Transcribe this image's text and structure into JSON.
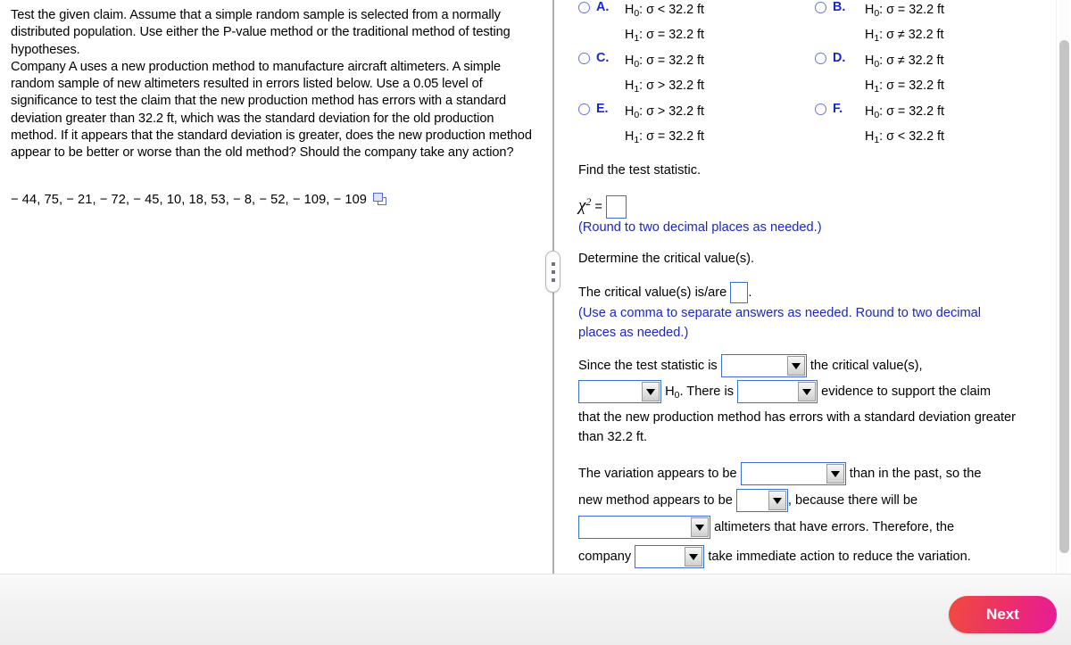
{
  "left_panel": {
    "instructions": "Test the given claim. Assume that a simple random sample is selected from a normally distributed population. Use either the P-value method or the traditional method of testing hypotheses.",
    "problem": "Company A uses a new production method to manufacture aircraft altimeters. A simple random sample of new altimeters resulted in errors listed below. Use a 0.05 level of significance to test the claim that the new production method has errors with a standard deviation greater than 32.2 ft, which was the standard deviation for the old production method. If it appears that the standard deviation is greater, does the new production method appear to be better or worse than the old method? Should the company take any action?",
    "data_values": "− 44, 75, − 21, − 72, − 45, 10, 18, 53, − 8, − 52, − 109, − 109",
    "copy_icon": "copy-to-clipboard-icon"
  },
  "right_panel": {
    "options": [
      {
        "letter": "A.",
        "null_label": "H",
        "null_sub": "0",
        "null_rest": ": σ < 32.2 ft",
        "alt_label": "H",
        "alt_sub": "1",
        "alt_rest": ": σ = 32.2 ft",
        "selected": false
      },
      {
        "letter": "B.",
        "null_label": "H",
        "null_sub": "0",
        "null_rest": ": σ = 32.2 ft",
        "alt_label": "H",
        "alt_sub": "1",
        "alt_rest": ": σ ≠ 32.2 ft",
        "selected": false
      },
      {
        "letter": "C.",
        "null_label": "H",
        "null_sub": "0",
        "null_rest": ": σ = 32.2 ft",
        "alt_label": "H",
        "alt_sub": "1",
        "alt_rest": ": σ > 32.2 ft",
        "selected": false
      },
      {
        "letter": "D.",
        "null_label": "H",
        "null_sub": "0",
        "null_rest": ": σ ≠ 32.2 ft",
        "alt_label": "H",
        "alt_sub": "1",
        "alt_rest": ": σ = 32.2 ft",
        "selected": false
      },
      {
        "letter": "E.",
        "null_label": "H",
        "null_sub": "0",
        "null_rest": ": σ > 32.2 ft",
        "alt_label": "H",
        "alt_sub": "1",
        "alt_rest": ": σ = 32.2 ft",
        "selected": false
      },
      {
        "letter": "F.",
        "null_label": "H",
        "null_sub": "0",
        "null_rest": ": σ = 32.2 ft",
        "alt_label": "H",
        "alt_sub": "1",
        "alt_rest": ": σ < 32.2 ft",
        "selected": false
      }
    ],
    "find_test_statistic": "Find the test statistic.",
    "chi_symbol": "χ",
    "chi_exponent": "2",
    "chi_equals": "=",
    "test_statistic_value": "",
    "round_note": "(Round to two decimal places as needed.)",
    "determine_critical": "Determine the critical value(s).",
    "critical_prefix": "The critical value(s) is/are",
    "critical_value": "",
    "critical_suffix": ".",
    "comma_note": "(Use a comma to separate answers as needed. Round to two decimal places as needed.)",
    "conclusion": {
      "since_prefix": "Since the test statistic is",
      "compare_value": "",
      "since_suffix": "the critical value(s),",
      "reject_value": "",
      "h_null_label": "H",
      "h_null_sub": "0",
      "there_is": ". There is",
      "evidence_value": "",
      "evidence_suffix": "evidence to support the claim",
      "tail": "that the new production method has errors with a standard deviation greater than 32.2 ft."
    },
    "interpretation": {
      "variation_prefix": "The variation appears to be",
      "variation_value": "",
      "variation_suffix": "than in the past, so the",
      "method_prefix": "new method appears to be",
      "method_value": "",
      "method_suffix": ", because there will be",
      "altimeters_value": "",
      "altimeters_suffix": "altimeters that have errors. Therefore, the",
      "company_prefix": "company",
      "company_value": "",
      "company_suffix": "take immediate action to reduce the variation."
    }
  },
  "bottom_bar": {
    "next_label": "Next"
  }
}
